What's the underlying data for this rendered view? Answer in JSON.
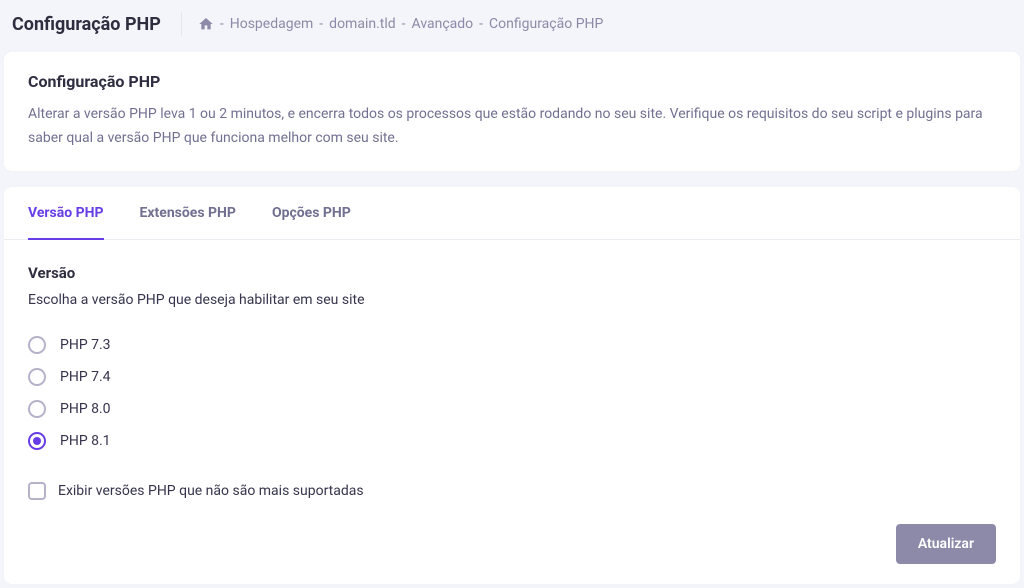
{
  "header": {
    "title": "Configuração PHP",
    "breadcrumb": {
      "item1": "Hospedagem",
      "item2": "domain.tld",
      "item3": "Avançado",
      "item4": "Configuração PHP"
    }
  },
  "info_card": {
    "title": "Configuração PHP",
    "description": "Alterar a versão PHP leva 1 ou 2 minutos, e encerra todos os processos que estão rodando no seu site. Verifique os requisitos do seu script e plugins para saber qual a versão PHP que funciona melhor com seu site."
  },
  "tabs": {
    "tab1": "Versão PHP",
    "tab2": "Extensões PHP",
    "tab3": "Opções PHP"
  },
  "version_section": {
    "title": "Versão",
    "description": "Escolha a versão PHP que deseja habilitar em seu site",
    "options": {
      "opt1": "PHP 7.3",
      "opt2": "PHP 7.4",
      "opt3": "PHP 8.0",
      "opt4": "PHP 8.1"
    },
    "selected": "PHP 8.1",
    "checkbox_label": "Exibir versões PHP que não são mais suportadas"
  },
  "actions": {
    "update": "Atualizar"
  }
}
